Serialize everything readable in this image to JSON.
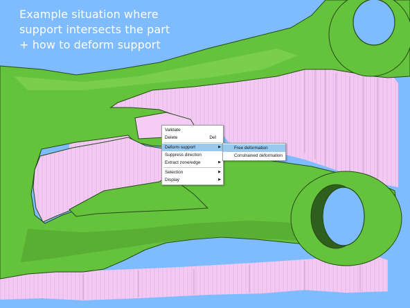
{
  "caption": {
    "lines": [
      "Example situation where",
      "support intersects the part",
      "+ how to deform support"
    ]
  },
  "colors": {
    "background": "#7ebcff",
    "part": "#64c23c",
    "part_dark": "#1f3d12",
    "support": "#f4c6f4",
    "menu_highlight": "#99c9ef"
  },
  "context_menu": {
    "items": [
      {
        "label": "Validate"
      },
      {
        "label": "Delete",
        "shortcut": "Del"
      },
      {
        "label": "Deform support",
        "has_submenu": true,
        "highlighted": true
      },
      {
        "label": "Suppress direction"
      },
      {
        "label": "Extract zone/edge",
        "has_submenu": true
      },
      {
        "label": "Selection",
        "has_submenu": true
      },
      {
        "label": "Display",
        "has_submenu": true
      }
    ]
  },
  "submenu": {
    "items": [
      {
        "label": "Free deformation",
        "highlighted": true
      },
      {
        "label": "Constrained deformation"
      }
    ]
  }
}
